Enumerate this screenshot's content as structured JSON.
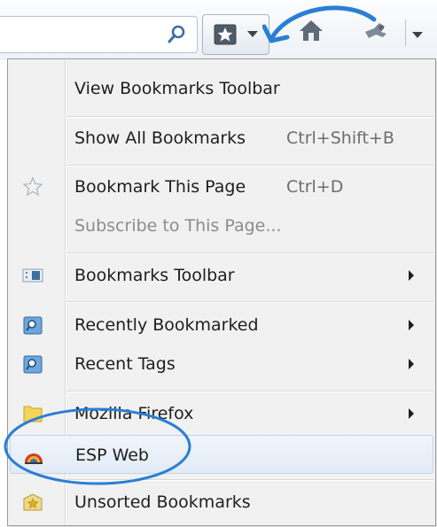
{
  "toolbar": {
    "url_value": "",
    "icons": {
      "search": "search-icon",
      "bookmarks": "star-icon",
      "home": "home-icon",
      "addon": "plugin-icon"
    }
  },
  "menu": {
    "items": [
      {
        "label": "View Bookmarks Toolbar",
        "shortcut": "",
        "submenu": false,
        "disabled": false
      },
      {
        "label": "Show All Bookmarks",
        "shortcut": "Ctrl+Shift+B",
        "submenu": false,
        "disabled": false
      },
      {
        "label": "Bookmark This Page",
        "shortcut": "Ctrl+D",
        "submenu": false,
        "disabled": false
      },
      {
        "label": "Subscribe to This Page...",
        "shortcut": "",
        "submenu": false,
        "disabled": true
      },
      {
        "label": "Bookmarks Toolbar",
        "shortcut": "",
        "submenu": true,
        "disabled": false
      },
      {
        "label": "Recently Bookmarked",
        "shortcut": "",
        "submenu": true,
        "disabled": false
      },
      {
        "label": "Recent Tags",
        "shortcut": "",
        "submenu": true,
        "disabled": false
      },
      {
        "label": "Mozilla Firefox",
        "shortcut": "",
        "submenu": true,
        "disabled": false
      },
      {
        "label": "ESP Web",
        "shortcut": "",
        "submenu": false,
        "disabled": false,
        "highlighted": true
      },
      {
        "label": "Unsorted Bookmarks",
        "shortcut": "",
        "submenu": false,
        "disabled": false
      }
    ]
  },
  "annotation_color": "#2a7fd4",
  "accent_color": "#3a6fb5"
}
